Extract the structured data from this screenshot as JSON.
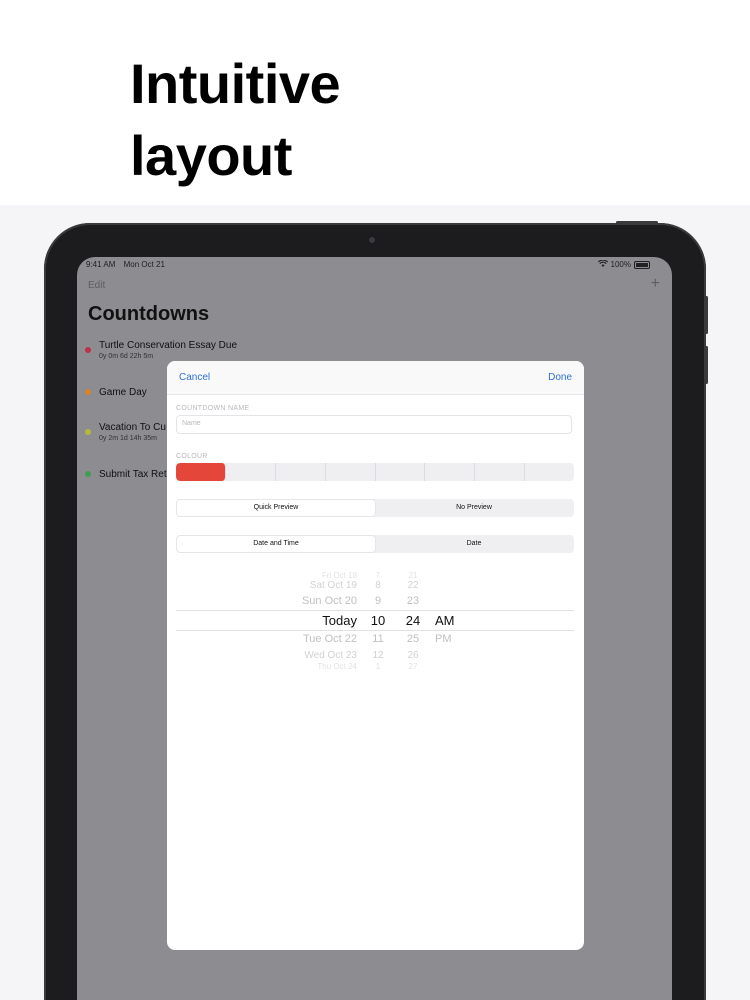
{
  "headline": {
    "line1": "Intuitive",
    "line2": "layout"
  },
  "status_bar": {
    "time": "9:41 AM",
    "date": "Mon Oct 21",
    "battery": "100%"
  },
  "nav": {
    "edit_label": "Edit",
    "add_label": "+"
  },
  "list": {
    "title": "Countdowns",
    "items": [
      {
        "name": "Turtle Conservation Essay Due",
        "remaining": "0y 0m 6d 22h 5m",
        "color": "#c0304a"
      },
      {
        "name": "Game Day",
        "remaining": "",
        "color": "#d9822b"
      },
      {
        "name": "Vacation To Cu",
        "remaining": "0y 2m 1d 14h 35m",
        "color": "#b8b83a"
      },
      {
        "name": "Submit Tax Ret",
        "remaining": "",
        "color": "#3f9f4f"
      }
    ]
  },
  "modal": {
    "cancel_label": "Cancel",
    "done_label": "Done",
    "name_label": "COUNTDOWN NAME",
    "name_placeholder": "Name",
    "colour_label": "COLOUR",
    "selected_colour": "#e4463a",
    "preview_options": [
      "Quick Preview",
      "No Preview"
    ],
    "mode_options": [
      "Date and Time",
      "Date"
    ]
  },
  "picker": {
    "dates": [
      "Fri Oct 18",
      "Sat Oct 19",
      "Sun Oct 20",
      "Today",
      "Tue Oct 22",
      "Wed Oct 23",
      "Thu Oct 24"
    ],
    "hours": [
      "7",
      "8",
      "9",
      "10",
      "11",
      "12",
      "1"
    ],
    "minutes": [
      "21",
      "22",
      "23",
      "24",
      "25",
      "26",
      "27"
    ],
    "ampm": [
      "AM",
      "PM"
    ]
  }
}
